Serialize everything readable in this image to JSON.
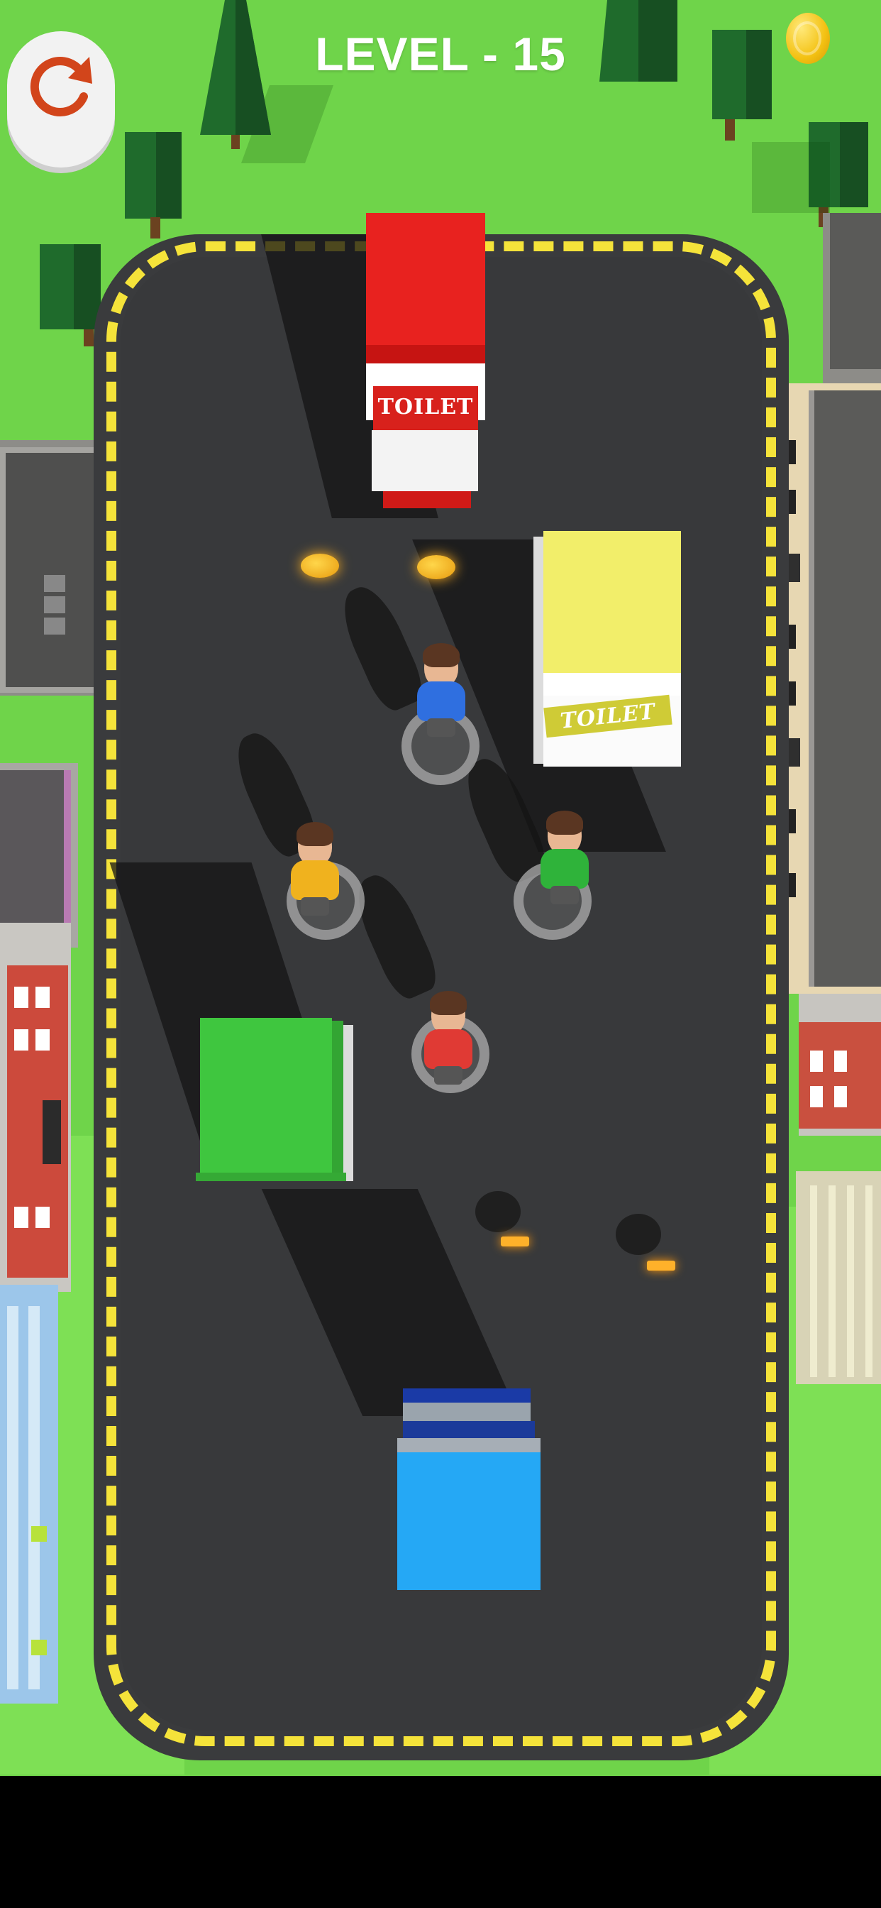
{
  "hud": {
    "level_text": "LEVEL - 15",
    "restart_icon": "restart-arrow-icon",
    "coin_icon": "gold-coin-icon"
  },
  "toilets": [
    {
      "color_name": "red",
      "color": "#e8221f",
      "label": "TOILET"
    },
    {
      "color_name": "yellow",
      "color": "#f2ee6a",
      "label": "TOILET"
    },
    {
      "color_name": "green",
      "color": "#3fc63f",
      "label": ""
    },
    {
      "color_name": "blue",
      "color": "#25a8f5",
      "label": ""
    }
  ],
  "characters": [
    {
      "shirt": "blue",
      "color": "#2f6fe0"
    },
    {
      "shirt": "yellow",
      "color": "#f0b21e"
    },
    {
      "shirt": "green",
      "color": "#2fb33a"
    },
    {
      "shirt": "red",
      "color": "#e03a34"
    }
  ],
  "colors": {
    "grass": "#6fd44a",
    "road": "#3a3b3d",
    "road_edge": "#f5e33a"
  }
}
